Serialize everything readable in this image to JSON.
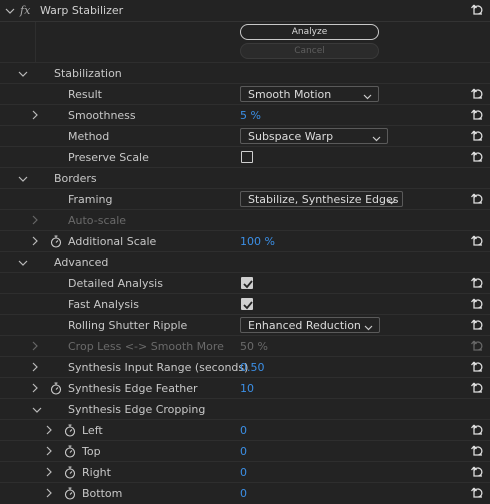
{
  "effect": {
    "fx": "fx",
    "name": "Warp Stabilizer"
  },
  "buttons": {
    "analyze": "Analyze",
    "cancel": "Cancel"
  },
  "sections": {
    "stabilization": "Stabilization",
    "borders": "Borders",
    "advanced": "Advanced",
    "cropping": "Synthesis Edge Cropping"
  },
  "params": {
    "result": {
      "label": "Result",
      "value": "Smooth Motion"
    },
    "smoothness": {
      "label": "Smoothness",
      "value": "5 %"
    },
    "method": {
      "label": "Method",
      "value": "Subspace Warp"
    },
    "preserve_scale": {
      "label": "Preserve Scale",
      "checked": false
    },
    "framing": {
      "label": "Framing",
      "value": "Stabilize, Synthesize Edges"
    },
    "auto_scale": {
      "label": "Auto-scale"
    },
    "additional_scale": {
      "label": "Additional Scale",
      "value": "100 %"
    },
    "detailed_analysis": {
      "label": "Detailed Analysis",
      "checked": true
    },
    "fast_analysis": {
      "label": "Fast Analysis",
      "checked": true
    },
    "rolling_shutter": {
      "label": "Rolling Shutter Ripple",
      "value": "Enhanced Reduction"
    },
    "crop_less": {
      "label": "Crop Less <-> Smooth More",
      "value": "50 %"
    },
    "input_range": {
      "label": "Synthesis Input Range (seconds)",
      "value": "0.50"
    },
    "edge_feather": {
      "label": "Synthesis Edge Feather",
      "value": "10"
    },
    "left": {
      "label": "Left",
      "value": "0"
    },
    "top": {
      "label": "Top",
      "value": "0"
    },
    "right": {
      "label": "Right",
      "value": "0"
    },
    "bottom": {
      "label": "Bottom",
      "value": "0"
    }
  },
  "colors": {
    "accent": "#3b8fe6",
    "background": "#232323",
    "disabled": "#6a6a6a"
  }
}
